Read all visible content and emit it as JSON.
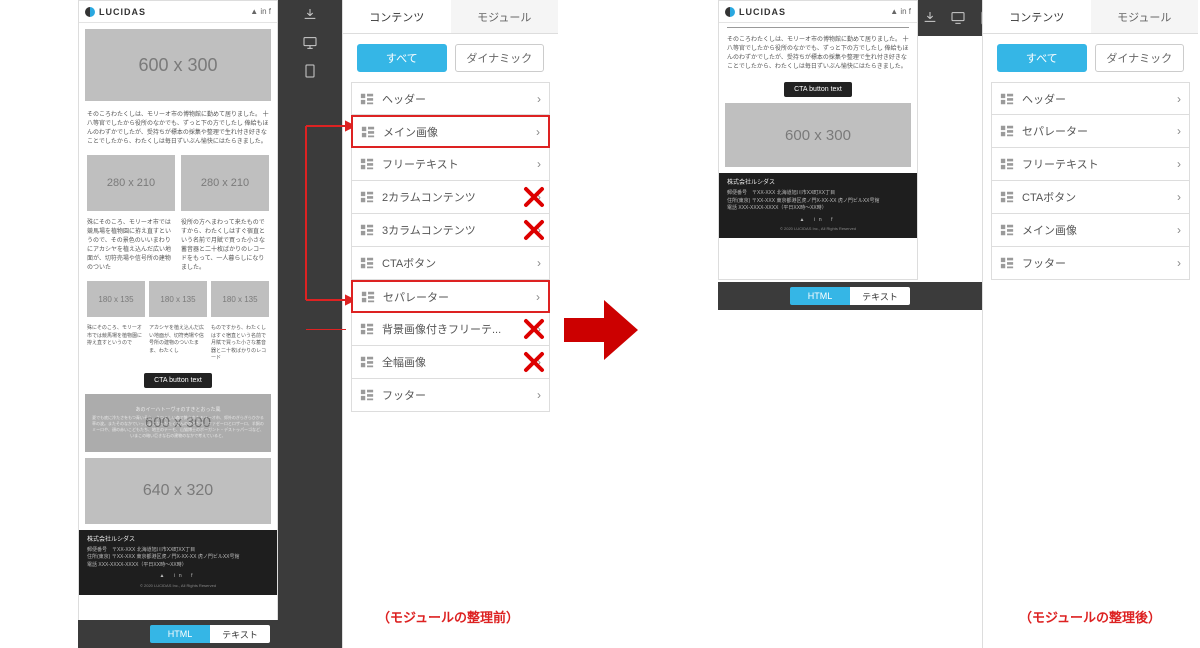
{
  "brand": "LUCIDAS",
  "cta_label": "CTA button text",
  "placeholders": {
    "p600x300": "600 x 300",
    "p280x210": "280 x 210",
    "p180x135": "180 x 135",
    "p640x320": "640 x 320"
  },
  "body_text": {
    "intro": "そのころわたくしは、モリーオ市の博物館に勤めて居りました。\n十八等官でしたから役所のなかでも、ずっと下の方でしたし 俸給もほんのわずかでしたが、受持ちが標本の採集や整理で生れ付き好きなことでしたから、わたくしは毎日ずいぶん愉快にはたらきました。",
    "col2a": "殊にそのころ、モリーオ市では競馬場を植物園に拵え直すというので、その景色のいいまわりにアカシヤを植え込んだ広い地面が、切符売場や信号所の建物のついた",
    "col2b": "役所の方へまわって来たものですから、わたくしはすぐ宿直という名前で月賦で買った小さな蓄音器と二十枚ばかりのレコードをもって、一人暮らしになりました。",
    "col3a": "殊にそのころ、モリーオ市では競馬場を植物園に拵え直すというので",
    "col3b": "アカシヤを植え込んだ広い地面が、切符売場や信号所の建物のついたまま、わたくし",
    "col3c": "ものですから、わたくしはすぐ宿直という名前で月賦で買った小さな蓄音器と二十枚ばかりのレコード",
    "hero_overlay_title": "あのイーハトーヴォのすきとおった風",
    "hero_overlay_body": "夏でも底に冷たさをもつ青いそら、うつくしい森で飾られたモリーオ市、郊外のぎらぎらひかる草の波。またそのなかでいっしょになったたくさんのひとたち、ファゼーロとロザーロ、羊飼のミーロや、顔の赤いこどもたち、地主のテーモ、山猫博士のボーガント・デストゥパーゴなど、いまこの暗い巨きな石の建物のなかで考えていると、"
  },
  "footer": {
    "company": "株式会社ルシダス",
    "lines": "郵便番号　〒XX-XXX 北海道旭川市XX町XX丁目\n住所(東京) 〒XX-XXX 東京都港区虎ノ門X-XX-XX 虎ノ門ビルXX号館\n電話 XXX-XXXX-XXXX（平日XX時〜XX時）",
    "copy": "© 2020 LUCIDAS Inc., All Rights Reserved"
  },
  "rail_icons": [
    "download-icon",
    "desktop-icon",
    "tablet-icon"
  ],
  "tabs": {
    "contents": "コンテンツ",
    "modules": "モジュール"
  },
  "filters": {
    "all": "すべて",
    "dynamic": "ダイナミック"
  },
  "modules_before": [
    {
      "label": "ヘッダー",
      "hl": false,
      "x": false
    },
    {
      "label": "メイン画像",
      "hl": true,
      "x": false
    },
    {
      "label": "フリーテキスト",
      "hl": false,
      "x": false
    },
    {
      "label": "2カラムコンテンツ",
      "hl": false,
      "x": true
    },
    {
      "label": "3カラムコンテンツ",
      "hl": false,
      "x": true
    },
    {
      "label": "CTAボタン",
      "hl": false,
      "x": false
    },
    {
      "label": "セパレーター",
      "hl": true,
      "x": false
    },
    {
      "label": "背景画像付きフリーテ...",
      "hl": false,
      "x": true
    },
    {
      "label": "全幅画像",
      "hl": false,
      "x": true
    },
    {
      "label": "フッター",
      "hl": false,
      "x": false
    }
  ],
  "modules_after": [
    {
      "label": "ヘッダー"
    },
    {
      "label": "セパレーター"
    },
    {
      "label": "フリーテキスト"
    },
    {
      "label": "CTAボタン"
    },
    {
      "label": "メイン画像"
    },
    {
      "label": "フッター"
    }
  ],
  "switch": {
    "html": "HTML",
    "text": "テキスト"
  },
  "captions": {
    "before": "（モジュールの整理前）",
    "after": "（モジュールの整理後）"
  }
}
